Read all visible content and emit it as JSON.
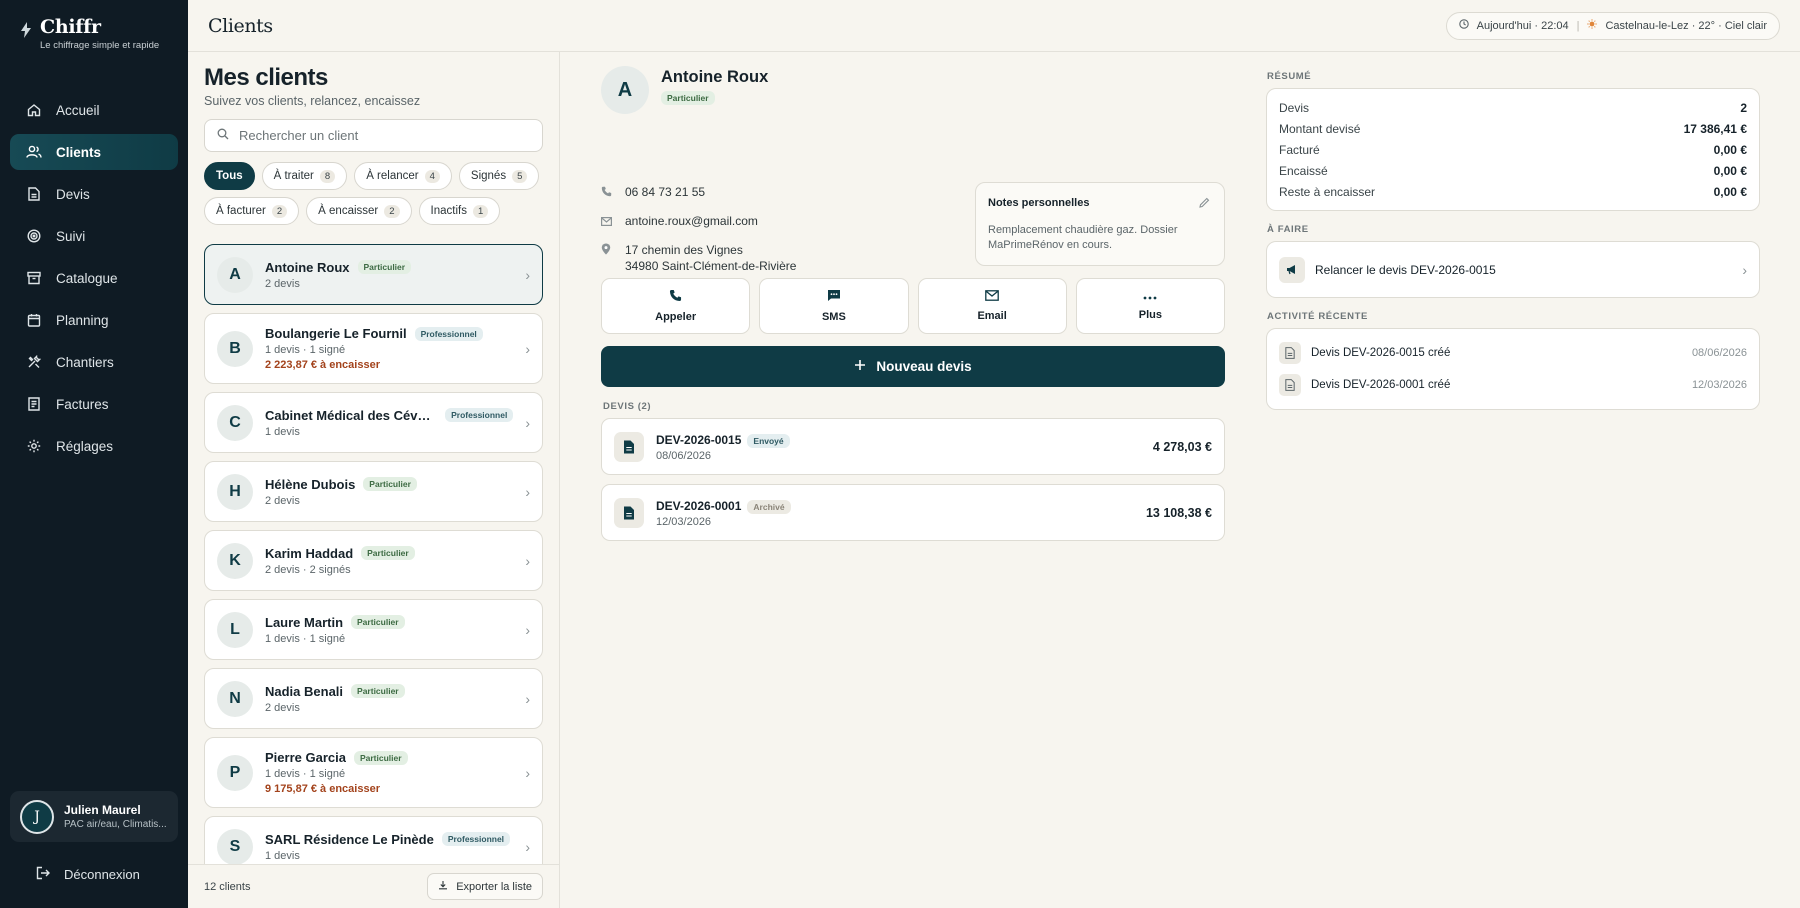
{
  "brand": {
    "name": "Chiffr",
    "tagline": "Le chiffrage simple et rapide"
  },
  "nav": [
    {
      "label": "Accueil",
      "icon": "home-icon"
    },
    {
      "label": "Clients",
      "icon": "users-icon",
      "active": true
    },
    {
      "label": "Devis",
      "icon": "document-icon"
    },
    {
      "label": "Suivi",
      "icon": "target-icon"
    },
    {
      "label": "Catalogue",
      "icon": "archive-icon"
    },
    {
      "label": "Planning",
      "icon": "calendar-icon"
    },
    {
      "label": "Chantiers",
      "icon": "tools-icon"
    },
    {
      "label": "Factures",
      "icon": "invoice-icon"
    },
    {
      "label": "Réglages",
      "icon": "gear-icon"
    }
  ],
  "user": {
    "initial": "J",
    "name": "Julien Maurel",
    "role": "PAC air/eau, Climatis..."
  },
  "logout_label": "Déconnexion",
  "topbar": {
    "title": "Clients",
    "time": "Aujourd'hui · 22:04",
    "weather": "Castelnau-le-Lez · 22° · Ciel clair"
  },
  "list": {
    "title": "Mes clients",
    "subtitle": "Suivez vos clients, relancez, encaissez",
    "search_placeholder": "Rechercher un client",
    "filters": [
      {
        "label": "Tous",
        "count": "",
        "active": true
      },
      {
        "label": "À traiter",
        "count": "8"
      },
      {
        "label": "À relancer",
        "count": "4"
      },
      {
        "label": "Signés",
        "count": "5"
      },
      {
        "label": "À facturer",
        "count": "2"
      },
      {
        "label": "À encaisser",
        "count": "2"
      },
      {
        "label": "Inactifs",
        "count": "1"
      }
    ],
    "clients": [
      {
        "initial": "A",
        "name": "Antoine Roux",
        "type": "Particulier",
        "meta": "2 devis",
        "amount": "",
        "selected": true
      },
      {
        "initial": "B",
        "name": "Boulangerie Le Fournil",
        "type": "Professionnel",
        "meta": "1 devis · 1 signé",
        "amount": "2 223,87 € à encaisser"
      },
      {
        "initial": "C",
        "name": "Cabinet Médical des Céven...",
        "type": "Professionnel",
        "meta": "1 devis",
        "amount": ""
      },
      {
        "initial": "H",
        "name": "Hélène Dubois",
        "type": "Particulier",
        "meta": "2 devis",
        "amount": ""
      },
      {
        "initial": "K",
        "name": "Karim Haddad",
        "type": "Particulier",
        "meta": "2 devis · 2 signés",
        "amount": ""
      },
      {
        "initial": "L",
        "name": "Laure Martin",
        "type": "Particulier",
        "meta": "1 devis · 1 signé",
        "amount": ""
      },
      {
        "initial": "N",
        "name": "Nadia Benali",
        "type": "Particulier",
        "meta": "2 devis",
        "amount": ""
      },
      {
        "initial": "P",
        "name": "Pierre Garcia",
        "type": "Particulier",
        "meta": "1 devis · 1 signé",
        "amount": "9 175,87 € à encaisser"
      },
      {
        "initial": "S",
        "name": "SARL Résidence Le Pinède",
        "type": "Professionnel",
        "meta": "1 devis",
        "amount": ""
      }
    ],
    "footer_count": "12 clients",
    "export_label": "Exporter la liste"
  },
  "detail": {
    "initial": "A",
    "name": "Antoine Roux",
    "type": "Particulier",
    "phone": "06 84 73 21 55",
    "email": "antoine.roux@gmail.com",
    "address_line1": "17 chemin des Vignes",
    "address_line2": "34980 Saint-Clément-de-Rivière",
    "notes_title": "Notes personnelles",
    "notes_text": "Remplacement chaudière gaz. Dossier MaPrimeRénov en cours.",
    "actions": [
      "Appeler",
      "SMS",
      "Email",
      "Plus"
    ],
    "new_quote_label": "Nouveau devis",
    "quotes_label": "DEVIS (2)",
    "quotes": [
      {
        "number": "DEV-2026-0015",
        "status": "Envoyé",
        "date": "08/06/2026",
        "amount": "4 278,03 €"
      },
      {
        "number": "DEV-2026-0001",
        "status": "Archivé",
        "date": "12/03/2026",
        "amount": "13 108,38 €"
      }
    ]
  },
  "summary": {
    "label": "RÉSUMÉ",
    "rows": [
      {
        "k": "Devis",
        "v": "2"
      },
      {
        "k": "Montant devisé",
        "v": "17 386,41 €"
      },
      {
        "k": "Facturé",
        "v": "0,00 €"
      },
      {
        "k": "Encaissé",
        "v": "0,00 €"
      },
      {
        "k": "Reste à encaisser",
        "v": "0,00 €"
      }
    ]
  },
  "todo": {
    "label": "À FAIRE",
    "item": "Relancer le devis DEV-2026-0015"
  },
  "activity": {
    "label": "ACTIVITÉ RÉCENTE",
    "items": [
      {
        "text": "Devis DEV-2026-0015 créé",
        "date": "08/06/2026"
      },
      {
        "text": "Devis DEV-2026-0001 créé",
        "date": "12/03/2026"
      }
    ]
  }
}
